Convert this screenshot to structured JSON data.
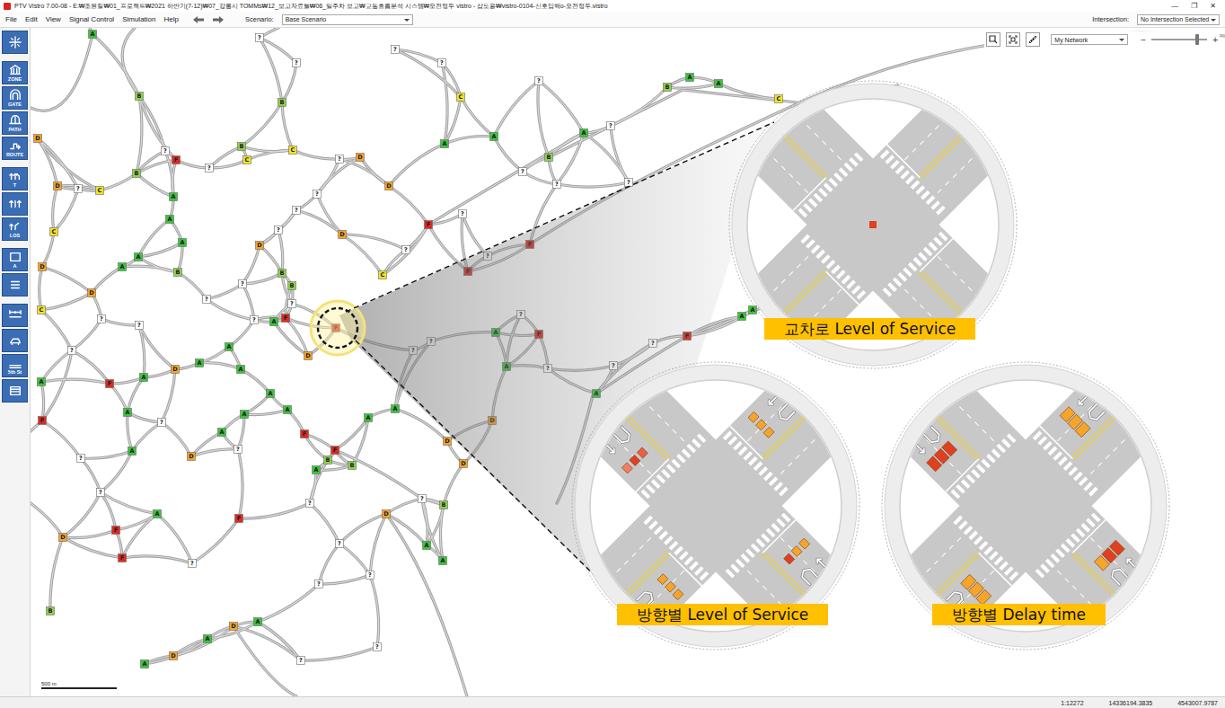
{
  "window": {
    "title": "PTV Vistro 7.00-08 - E:₩조원질₩01_프로젝트₩2021 하반기(7-12)₩07_강릉시 TOMMs₩12_보고자료들₩06_일주차 보고₩교통흐름분석 시스템₩오전정두 vistro - 삽도용₩vistro-0104-신호입력o-오전정두.vistro",
    "controls": [
      "—",
      "❐",
      "✕"
    ]
  },
  "menu": [
    "File",
    "Edit",
    "View",
    "Signal Control",
    "Simulation",
    "Help"
  ],
  "scenario": {
    "label": "Scenario:",
    "value": "Base Scenario"
  },
  "intersection": {
    "label": "Intersection:",
    "value": "No Intersection Selected"
  },
  "toolbar": [
    [
      {
        "kind": "intersection"
      }
    ],
    [
      {
        "kind": "zone",
        "label": "ZONE"
      },
      {
        "kind": "gate",
        "label": "GATE"
      },
      {
        "kind": "path",
        "label": "PATH"
      },
      {
        "kind": "route",
        "label": "ROUTE"
      }
    ],
    [
      {
        "kind": "turn",
        "label": "T"
      },
      {
        "kind": "lanes"
      },
      {
        "kind": "los",
        "label": "LOS"
      }
    ],
    [
      {
        "kind": "label",
        "label": "A"
      },
      {
        "kind": "list"
      }
    ],
    [
      {
        "kind": "measure"
      },
      {
        "kind": "signal"
      },
      {
        "kind": "street",
        "label": "5th St"
      },
      {
        "kind": "table"
      }
    ]
  ],
  "map_toolbar": {
    "network": "My Network",
    "zoom_out": "−",
    "zoom_in": "+",
    "zoom_level": 0.82
  },
  "nodes": [
    {
      "los": "A",
      "color": "#3cc43c",
      "highlighted": false
    },
    {
      "los": "B",
      "color": "#90d050",
      "highlighted": false
    },
    {
      "los": "?",
      "color": "#ffffff",
      "highlighted": false
    },
    {
      "los": "F",
      "color": "#dc2a20",
      "highlighted": false
    },
    {
      "los": "B",
      "color": "#90d050",
      "highlighted": false
    },
    {
      "los": "?",
      "color": "#ffffff",
      "highlighted": false
    },
    {
      "los": "B",
      "color": "#90d050",
      "highlighted": false
    },
    {
      "los": "C",
      "color": "#f2e32a",
      "highlighted": false
    },
    {
      "los": "C",
      "color": "#f2e32a",
      "highlighted": false
    },
    {
      "los": "D",
      "color": "#f4a52a",
      "highlighted": false
    },
    {
      "los": "D",
      "color": "#f4a52a",
      "highlighted": false
    },
    {
      "los": "C",
      "color": "#f2e32a",
      "highlighted": false
    },
    {
      "los": "C",
      "color": "#f2e32a",
      "highlighted": false
    },
    {
      "los": "D",
      "color": "#f4a52a",
      "highlighted": false
    },
    {
      "los": "D",
      "color": "#f4a52a",
      "highlighted": false
    },
    {
      "los": "C",
      "color": "#f2e32a",
      "highlighted": false
    },
    {
      "los": "?",
      "color": "#ffffff",
      "highlighted": false
    },
    {
      "los": "A",
      "color": "#3cc43c",
      "highlighted": false
    },
    {
      "los": "A",
      "color": "#3cc43c",
      "highlighted": false
    },
    {
      "los": "A",
      "color": "#3cc43c",
      "highlighted": false
    },
    {
      "los": "A",
      "color": "#3cc43c",
      "highlighted": false
    },
    {
      "los": "A",
      "color": "#3cc43c",
      "highlighted": false
    },
    {
      "los": "B",
      "color": "#90d050",
      "highlighted": false
    },
    {
      "los": "D",
      "color": "#f4a52a",
      "highlighted": false
    },
    {
      "los": "B",
      "color": "#90d050",
      "highlighted": false
    },
    {
      "los": "B",
      "color": "#90d050",
      "highlighted": false
    },
    {
      "los": "?",
      "color": "#ffffff",
      "highlighted": false
    },
    {
      "los": "F",
      "color": "#dc2a20",
      "highlighted": false
    },
    {
      "los": "A",
      "color": "#3cc43c",
      "highlighted": false
    },
    {
      "los": "?",
      "color": "#ffffff",
      "highlighted": false
    },
    {
      "los": "D",
      "color": "#f4a52a",
      "highlighted": false
    },
    {
      "los": "C",
      "color": "#f2e32a",
      "highlighted": false
    },
    {
      "los": "D",
      "color": "#f4a52a",
      "highlighted": false
    },
    {
      "los": "D",
      "color": "#f4a52a",
      "highlighted": false
    },
    {
      "los": "?",
      "color": "#ffffff",
      "highlighted": false
    },
    {
      "los": "?",
      "color": "#ffffff",
      "highlighted": false
    },
    {
      "los": "F",
      "color": "#dc2a20",
      "highlighted": true
    },
    {
      "los": "D",
      "color": "#f4a52a",
      "highlighted": false
    },
    {
      "los": "A",
      "color": "#3cc43c",
      "highlighted": false
    },
    {
      "los": "A",
      "color": "#3cc43c",
      "highlighted": false
    },
    {
      "los": "A",
      "color": "#3cc43c",
      "highlighted": false
    },
    {
      "los": "A",
      "color": "#3cc43c",
      "highlighted": false
    },
    {
      "los": "D",
      "color": "#f4a52a",
      "highlighted": false
    },
    {
      "los": "A",
      "color": "#3cc43c",
      "highlighted": false
    },
    {
      "los": "F",
      "color": "#dc2a20",
      "highlighted": false
    },
    {
      "los": "A",
      "color": "#3cc43c",
      "highlighted": false
    },
    {
      "los": "F",
      "color": "#dc2a20",
      "highlighted": false
    },
    {
      "los": "A",
      "color": "#3cc43c",
      "highlighted": false
    },
    {
      "los": "A",
      "color": "#3cc43c",
      "highlighted": false
    },
    {
      "los": "D",
      "color": "#f4a52a",
      "highlighted": false
    },
    {
      "los": "A",
      "color": "#3cc43c",
      "highlighted": false
    },
    {
      "los": "A",
      "color": "#3cc43c",
      "highlighted": false
    },
    {
      "los": "A",
      "color": "#3cc43c",
      "highlighted": false
    },
    {
      "los": "F",
      "color": "#dc2a20",
      "highlighted": false
    },
    {
      "los": "F",
      "color": "#dc2a20",
      "highlighted": false
    },
    {
      "los": "A",
      "color": "#3cc43c",
      "highlighted": false
    },
    {
      "los": "B",
      "color": "#90d050",
      "highlighted": false
    },
    {
      "los": "B",
      "color": "#90d050",
      "highlighted": false
    },
    {
      "los": "F",
      "color": "#dc2a20",
      "highlighted": false
    },
    {
      "los": "A",
      "color": "#3cc43c",
      "highlighted": false
    },
    {
      "los": "F",
      "color": "#dc2a20",
      "highlighted": false
    },
    {
      "los": "F",
      "color": "#dc2a20",
      "highlighted": false
    },
    {
      "los": "D",
      "color": "#f4a52a",
      "highlighted": false
    },
    {
      "los": "B",
      "color": "#90d050",
      "highlighted": false
    },
    {
      "los": "A",
      "color": "#3cc43c",
      "highlighted": false
    },
    {
      "los": "D",
      "color": "#f4a52a",
      "highlighted": false
    },
    {
      "los": "A",
      "color": "#3cc43c",
      "highlighted": false
    },
    {
      "los": "D",
      "color": "#f4a52a",
      "highlighted": false
    },
    {
      "los": "A",
      "color": "#3cc43c",
      "highlighted": false
    },
    {
      "los": "D",
      "color": "#f4a52a",
      "highlighted": false
    },
    {
      "los": "A",
      "color": "#3cc43c",
      "highlighted": false
    },
    {
      "los": "A",
      "color": "#3cc43c",
      "highlighted": false
    },
    {
      "los": "B",
      "color": "#90d050",
      "highlighted": false
    },
    {
      "los": "D",
      "color": "#f4a52a",
      "highlighted": false
    },
    {
      "los": "D",
      "color": "#f4a52a",
      "highlighted": false
    },
    {
      "los": "A",
      "color": "#3cc43c",
      "highlighted": false
    },
    {
      "los": "A",
      "color": "#3cc43c",
      "highlighted": false
    },
    {
      "los": "F",
      "color": "#dc2a20",
      "highlighted": false
    },
    {
      "los": "F",
      "color": "#dc2a20",
      "highlighted": false
    },
    {
      "los": "F",
      "color": "#dc2a20",
      "highlighted": false
    },
    {
      "los": "F",
      "color": "#dc2a20",
      "highlighted": false
    },
    {
      "los": "A",
      "color": "#3cc43c",
      "highlighted": false
    },
    {
      "los": "A",
      "color": "#3cc43c",
      "highlighted": false
    },
    {
      "los": "D",
      "color": "#f4a52a",
      "highlighted": false
    },
    {
      "los": "A",
      "color": "#3cc43c",
      "highlighted": false
    },
    {
      "los": "F",
      "color": "#dc2a20",
      "highlighted": false
    },
    {
      "los": "A",
      "color": "#3cc43c",
      "highlighted": false
    },
    {
      "los": "A",
      "color": "#3cc43c",
      "highlighted": false
    },
    {
      "los": "B",
      "color": "#90d050",
      "highlighted": false
    },
    {
      "los": "A",
      "color": "#3cc43c",
      "highlighted": false
    },
    {
      "los": "A",
      "color": "#3cc43c",
      "highlighted": false
    },
    {
      "los": "C",
      "color": "#f2e32a",
      "highlighted": false
    },
    {
      "los": "A",
      "color": "#3cc43c",
      "highlighted": false
    },
    {
      "los": "B",
      "color": "#90d050",
      "highlighted": false
    },
    {
      "los": "C",
      "color": "#f2e32a",
      "highlighted": false
    },
    {
      "los": "A",
      "color": "#3cc43c",
      "highlighted": false
    },
    {
      "los": "B",
      "color": "#90d050",
      "highlighted": false
    },
    {
      "los": "A",
      "color": "#3cc43c",
      "highlighted": false
    },
    {
      "los": "?",
      "color": "#ffffff",
      "highlighted": false
    },
    {
      "los": "?",
      "color": "#ffffff",
      "highlighted": false
    },
    {
      "los": "?",
      "color": "#ffffff",
      "highlighted": false
    },
    {
      "los": "?",
      "color": "#ffffff",
      "highlighted": false
    },
    {
      "los": "?",
      "color": "#ffffff",
      "highlighted": false
    },
    {
      "los": "?",
      "color": "#ffffff",
      "highlighted": false
    },
    {
      "los": "?",
      "color": "#ffffff",
      "highlighted": false
    },
    {
      "los": "?",
      "color": "#ffffff",
      "highlighted": false
    },
    {
      "los": "?",
      "color": "#ffffff",
      "highlighted": false
    },
    {
      "los": "?",
      "color": "#ffffff",
      "highlighted": false
    },
    {
      "los": "?",
      "color": "#ffffff",
      "highlighted": false
    },
    {
      "los": "?",
      "color": "#ffffff",
      "highlighted": false
    },
    {
      "los": "?",
      "color": "#ffffff",
      "highlighted": false
    },
    {
      "los": "?",
      "color": "#ffffff",
      "highlighted": false
    },
    {
      "los": "?",
      "color": "#ffffff",
      "highlighted": false
    },
    {
      "los": "?",
      "color": "#ffffff",
      "highlighted": false
    },
    {
      "los": "?",
      "color": "#ffffff",
      "highlighted": false
    },
    {
      "los": "?",
      "color": "#ffffff",
      "highlighted": false
    },
    {
      "los": "?",
      "color": "#ffffff",
      "highlighted": false
    },
    {
      "los": "?",
      "color": "#ffffff",
      "highlighted": false
    },
    {
      "los": "?",
      "color": "#ffffff",
      "highlighted": false
    },
    {
      "los": "?",
      "color": "#ffffff",
      "highlighted": false
    },
    {
      "los": "?",
      "color": "#ffffff",
      "highlighted": false
    },
    {
      "los": "?",
      "color": "#ffffff",
      "highlighted": false
    },
    {
      "los": "?",
      "color": "#ffffff",
      "highlighted": false
    },
    {
      "los": "?",
      "color": "#ffffff",
      "highlighted": false
    },
    {
      "los": "?",
      "color": "#ffffff",
      "highlighted": false
    },
    {
      "los": "?",
      "color": "#ffffff",
      "highlighted": false
    },
    {
      "los": "?",
      "color": "#ffffff",
      "highlighted": false
    },
    {
      "los": "?",
      "color": "#ffffff",
      "highlighted": false
    },
    {
      "los": "?",
      "color": "#ffffff",
      "highlighted": false
    },
    {
      "los": "?",
      "color": "#ffffff",
      "highlighted": false
    },
    {
      "los": "?",
      "color": "#ffffff",
      "highlighted": false
    },
    {
      "los": "?",
      "color": "#ffffff",
      "highlighted": false
    },
    {
      "los": "?",
      "color": "#ffffff",
      "highlighted": false
    },
    {
      "los": "?",
      "color": "#ffffff",
      "highlighted": false
    },
    {
      "los": "?",
      "color": "#ffffff",
      "highlighted": false
    }
  ],
  "scale": "500 m",
  "insets": [
    {
      "label": "교차로 Level of Service",
      "kind": "intersection",
      "center_color": "#e0401c"
    },
    {
      "label": "방향별 Level of Service",
      "kind": "direction-los",
      "approaches": [
        {
          "colors": [
            "#f4a52a",
            "#f4a52a",
            "#f4a52a"
          ]
        },
        {
          "colors": [
            "#f4a52a",
            "#f4a52a",
            "#e04020"
          ]
        },
        {
          "colors": [
            "#f4a52a",
            "#f4a52a",
            "#f4a52a"
          ]
        },
        {
          "colors": [
            "#f08060",
            "#e04020",
            "#e86040"
          ]
        }
      ]
    },
    {
      "label": "방향별 Delay time",
      "kind": "direction-delay",
      "approaches": [
        {
          "colors": [
            "#f4a52a",
            "#f4a52a",
            "#f4a52a"
          ]
        },
        {
          "colors": [
            "#e04020",
            "#e04020",
            "#f4a52a"
          ]
        },
        {
          "colors": [
            "#f4a52a",
            "#f4a52a",
            "#f4a52a"
          ]
        },
        {
          "colors": [
            "#e04020",
            "#e04020",
            "#e04020"
          ]
        }
      ]
    }
  ],
  "status_bar": [
    "1:12272",
    "14336194.3835",
    "4543007.9787"
  ]
}
